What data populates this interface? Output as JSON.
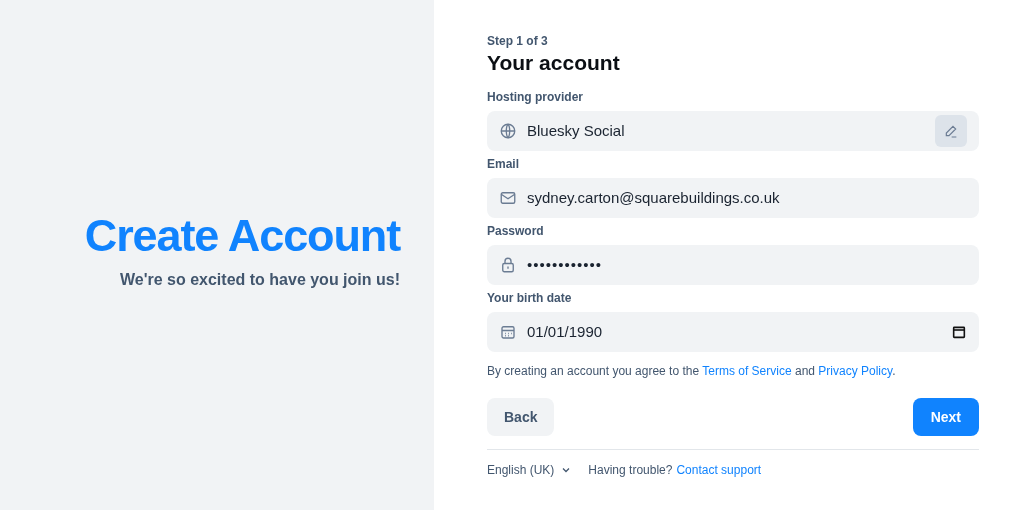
{
  "hero": {
    "title": "Create Account",
    "subtitle": "We're so excited to have you join us!"
  },
  "form": {
    "step": "Step 1 of 3",
    "title": "Your account",
    "fields": [
      {
        "kind": "provider",
        "label": "Hosting provider",
        "value": "Bluesky Social"
      },
      {
        "kind": "email",
        "label": "Email",
        "value": "sydney.carton@squarebuildings.co.uk"
      },
      {
        "kind": "password",
        "label": "Password",
        "value": "••••••••••••"
      },
      {
        "kind": "date",
        "label": "Your birth date",
        "value": "01/01/1990"
      }
    ],
    "agreement": {
      "before": "By creating an account you agree to the",
      "link_1": "Terms of Service",
      "middle": "and",
      "link_2": "Privacy Policy",
      "after": "."
    },
    "buttons": {
      "back": "Back",
      "next": "Next"
    }
  },
  "footer": {
    "language": "English (UK)",
    "trouble": "Having trouble?",
    "support_link": "Contact support"
  }
}
